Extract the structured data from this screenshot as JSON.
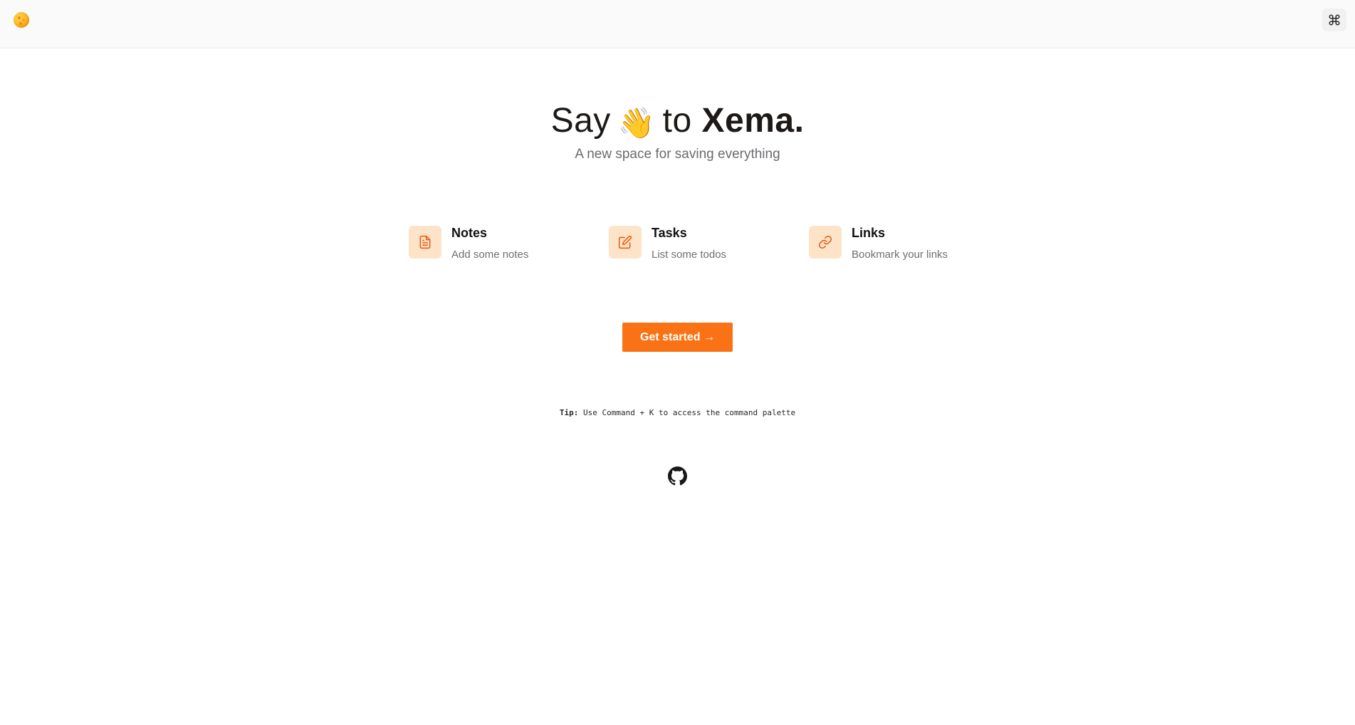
{
  "header": {
    "logo_icon": "cookie-logo-icon",
    "command_icon": "command-key-icon"
  },
  "hero": {
    "title_prefix": "Say",
    "wave_emoji": "👋",
    "title_mid": "to",
    "brand": "Xema.",
    "subtitle": "A new space for saving everything"
  },
  "features": [
    {
      "title": "Notes",
      "description": "Add some notes",
      "icon": "document-icon"
    },
    {
      "title": "Tasks",
      "description": "List some todos",
      "icon": "edit-icon"
    },
    {
      "title": "Links",
      "description": "Bookmark your links",
      "icon": "link-icon"
    }
  ],
  "cta": {
    "label": "Get started →"
  },
  "tip": {
    "label": "Tip:",
    "text": "Use Command + K to access the command palette"
  },
  "footer": {
    "icon": "github-icon"
  },
  "colors": {
    "accent": "#f97316",
    "icon_bg": "#fde3c8",
    "topbar_bg": "#fafafa"
  }
}
